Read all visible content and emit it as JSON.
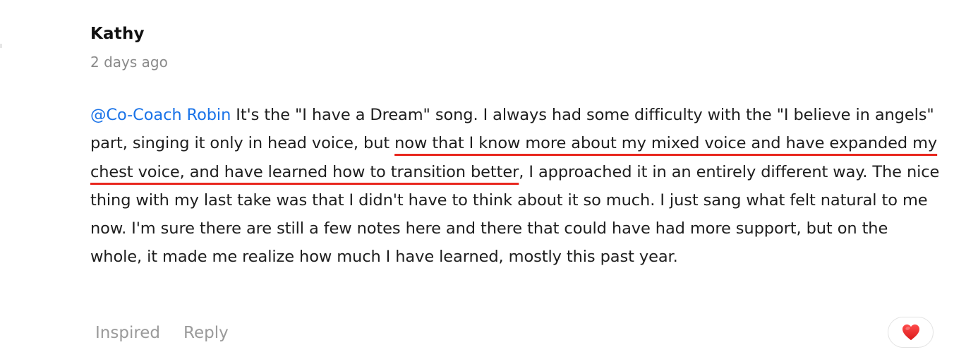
{
  "comment": {
    "author": "Kathy",
    "timestamp": "2 days ago",
    "mention": "@Co-Coach Robin",
    "text_before_highlight": " It's the \"I have a Dream\" song. I always had some difficulty with the \"I believe in angels\" part, singing it only in head voice, but ",
    "highlighted_text": "now that I know more about my mixed voice and have expanded my chest voice, and have learned how to transition better",
    "text_after_highlight": ", I approached it in an entirely different way. The nice thing with my last take was that I didn't have to think about it so much. I just sang what felt natural to me now. I'm sure there are still a few notes here and there that could have had more support, but on the whole, it made me realize how much I have learned, mostly this past year."
  },
  "actions": {
    "inspired_label": "Inspired",
    "reply_label": "Reply"
  },
  "reaction": {
    "icon": "heart-icon",
    "color": "#e8271e"
  },
  "colors": {
    "mention": "#1a73e8",
    "underline": "#e8271e",
    "muted_text": "#8a8a8a",
    "action_text": "#9a9a9a"
  }
}
